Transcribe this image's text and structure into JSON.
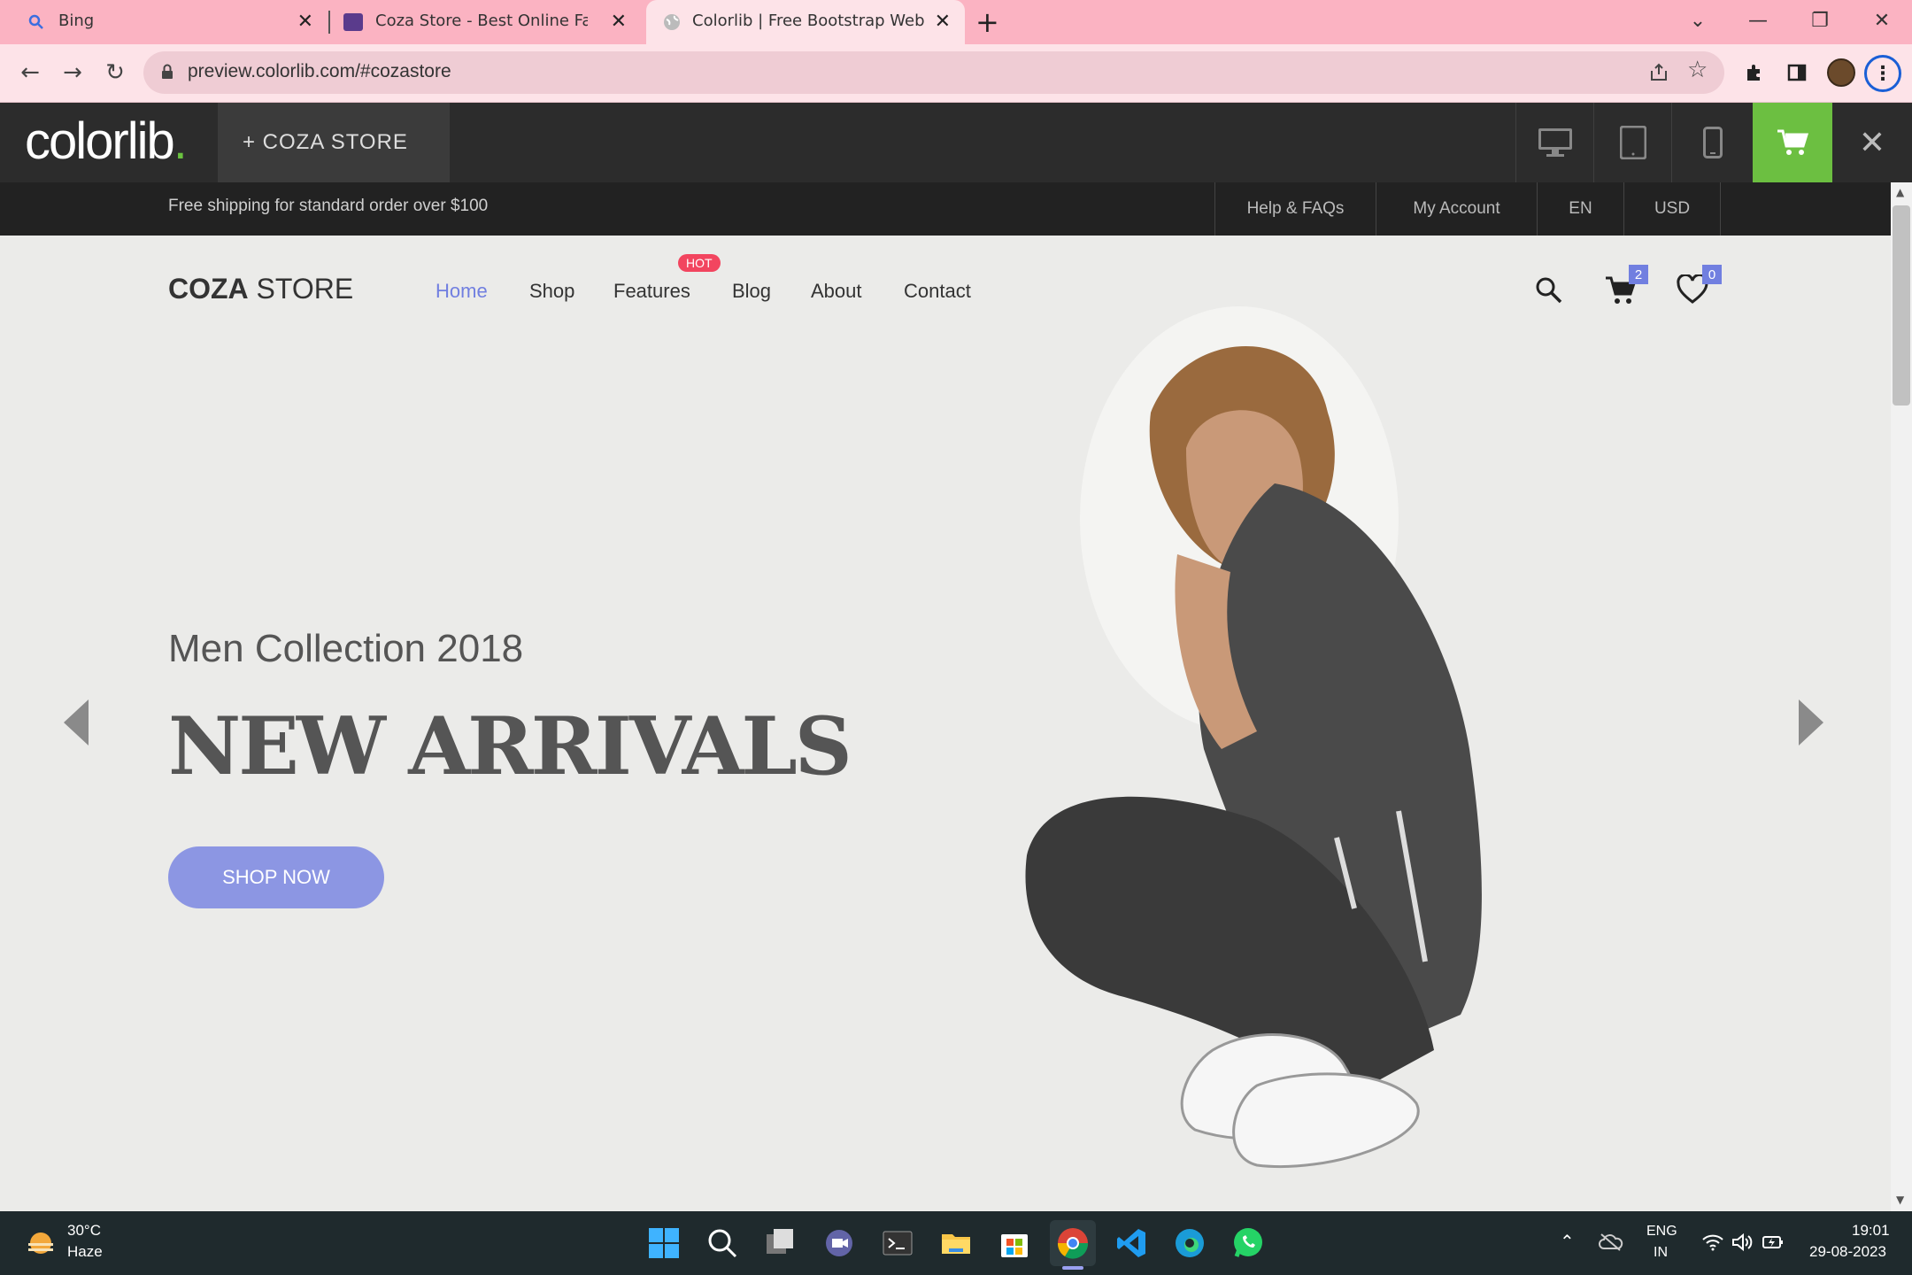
{
  "browser": {
    "tabs": [
      {
        "title": "Bing"
      },
      {
        "title": "Coza Store - Best Online Fashion"
      },
      {
        "title": "Colorlib | Free Bootstrap Website"
      }
    ],
    "new_tab_label": "+",
    "url": "preview.colorlib.com/#cozastore"
  },
  "colorlib_bar": {
    "logo": "colorlib",
    "logo_dot": ".",
    "store_tab": "+  COZA STORE"
  },
  "topbar": {
    "shipping": "Free shipping for standard order over $100",
    "links": [
      "Help & FAQs",
      "My Account",
      "EN",
      "USD"
    ]
  },
  "header": {
    "brand_bold": "COZA",
    "brand_light": " STORE",
    "nav": [
      "Home",
      "Shop",
      "Features",
      "Blog",
      "About",
      "Contact"
    ],
    "hot_badge": "HOT",
    "cart_count": "2",
    "wishlist_count": "0"
  },
  "hero": {
    "subtitle": "Men Collection 2018",
    "title": "NEW ARRIVALS",
    "button": "SHOP NOW"
  },
  "taskbar": {
    "weather_temp": "30°C",
    "weather_desc": "Haze",
    "lang_top": "ENG",
    "lang_bottom": "IN",
    "time": "19:01",
    "date": "29-08-2023"
  },
  "colors": {
    "accent": "#717fe0",
    "hot": "#f2455f",
    "cart_green": "#6cbf41",
    "tab_pink": "#fbb3c2"
  }
}
